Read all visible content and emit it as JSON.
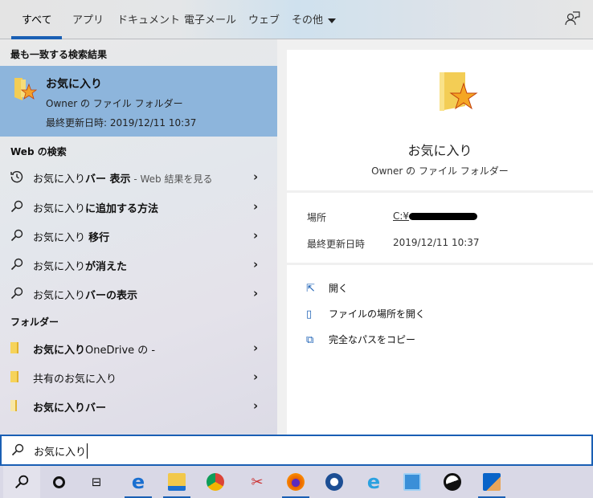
{
  "tabs": [
    {
      "label": "すべて"
    },
    {
      "label": "アプリ"
    },
    {
      "label": "ドキュメント"
    },
    {
      "label": "電子メール"
    },
    {
      "label": "ウェブ"
    },
    {
      "label": "その他"
    }
  ],
  "sections": {
    "best": "最も一致する検索結果",
    "web": "Web の検索",
    "folders": "フォルダー"
  },
  "best_match": {
    "title": "お気に入り",
    "subtitle": "Owner の ファイル フォルダー",
    "modified": "最終更新日時: 2019/12/11 10:37"
  },
  "web_results": [
    {
      "icon": "history-icon",
      "normal": "お気に入り",
      "bold": "バー 表示",
      "suffix": " - Web 結果を見る"
    },
    {
      "icon": "search-icon",
      "normal": "お気に入り",
      "bold": "に追加する方法"
    },
    {
      "icon": "search-icon",
      "normal": "お気に入り ",
      "bold": "移行"
    },
    {
      "icon": "search-icon",
      "normal": "お気に入り",
      "bold": "が消えた"
    },
    {
      "icon": "search-icon",
      "normal": "お気に入り",
      "bold": "バーの表示"
    }
  ],
  "folder_results": [
    {
      "bold": "お気に入り",
      "normal": "OneDrive の -"
    },
    {
      "bold": "",
      "normal": "共有のお気に入り"
    },
    {
      "bold": "お気に入りバー",
      "normal": ""
    }
  ],
  "preview": {
    "title": "お気に入り",
    "subtitle": "Owner の ファイル フォルダー",
    "location_label": "場所",
    "location_value": "C:¥",
    "modified_label": "最終更新日時",
    "modified_value": "2019/12/11 10:37",
    "actions": [
      {
        "label": "開く"
      },
      {
        "label": "ファイルの場所を開く"
      },
      {
        "label": "完全なパスをコピー"
      }
    ]
  },
  "search": {
    "value": "お気に入り"
  },
  "taskbar": [
    "search",
    "cortana",
    "task-view",
    "edge",
    "file-explorer",
    "chrome",
    "snipping-tool",
    "firefox",
    "thunderbird",
    "internet-explorer",
    "control-panel",
    "app",
    "outlook"
  ],
  "colors": {
    "accent": "#1a5fb4",
    "highlight": "#8db5dc"
  }
}
